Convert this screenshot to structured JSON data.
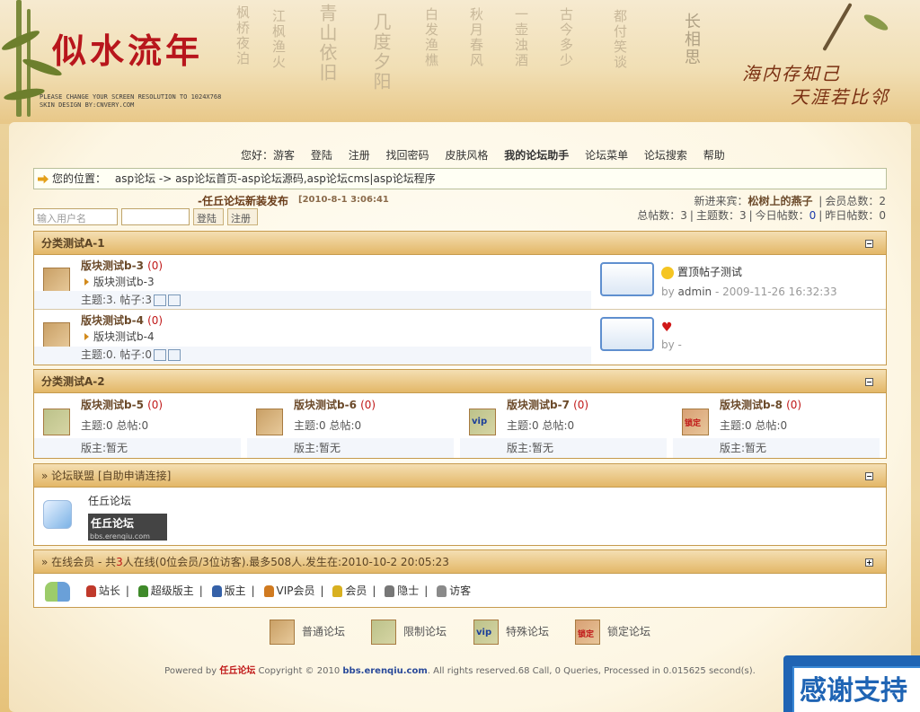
{
  "banner": {
    "title": "似水流年",
    "resolution_note": "PLEASE CHANGE YOUR SCREEN RESOLUTION TO 1024X768",
    "skin_note": "SKIN DESIGN BY:CNVERY.COM",
    "slogan_line1": "海内存知己",
    "slogan_line2": "天涯若比邻"
  },
  "nav": {
    "greeting": "您好：游客",
    "items": [
      "登陆",
      "注册",
      "找回密码",
      "皮肤风格",
      "我的论坛助手",
      "论坛菜单",
      "论坛搜索",
      "帮助"
    ]
  },
  "location": {
    "label": "您的位置：",
    "path": "asp论坛 -> asp论坛首页-asp论坛源码,asp论坛cms|asp论坛程序"
  },
  "login": {
    "username_placeholder": "输入用户名",
    "login_button": "登陆",
    "register_button": "注册"
  },
  "news": {
    "title": "-任丘论坛新装发布",
    "date": "[2010-8-1 3:06:41"
  },
  "stats": {
    "newest_label": "新进来宾：",
    "newest_member": "松树上的燕子",
    "member_total_label": "会员总数：",
    "member_total": "2",
    "posts_label": "总帖数：",
    "posts": "3",
    "topics_label": "主题数：",
    "topics": "3",
    "today_label": "今日帖数：",
    "today": "0",
    "yesterday_label": "昨日帖数：",
    "yesterday": "0"
  },
  "categoryA1": {
    "title": "分类测试A-1",
    "boards": [
      {
        "name": "版块测试b-3",
        "count": "(0)",
        "sub": "版块测试b-3",
        "meta": "主题:3. 帖子:3",
        "last_title": "置顶帖子测试",
        "last_by": "by",
        "last_user": "admin",
        "last_time": "- 2009-11-26 16:32:33"
      },
      {
        "name": "版块测试b-4",
        "count": "(0)",
        "sub": "版块测试b-4",
        "meta": "主题:0. 帖子:0",
        "last_title": "",
        "last_by": "by -",
        "last_user": "",
        "last_time": ""
      }
    ]
  },
  "categoryA2": {
    "title": "分类测试A-2",
    "boards": [
      {
        "name": "版块测试b-5",
        "count": "(0)",
        "meta": "主题:0 总帖:0",
        "mod": "版主:暂无",
        "icon_label": ""
      },
      {
        "name": "版块测试b-6",
        "count": "(0)",
        "meta": "主题:0 总帖:0",
        "mod": "版主:暂无",
        "icon_label": ""
      },
      {
        "name": "版块测试b-7",
        "count": "(0)",
        "meta": "主题:0 总帖:0",
        "mod": "版主:暂无",
        "icon_label": "vip"
      },
      {
        "name": "版块测试b-8",
        "count": "(0)",
        "meta": "主题:0 总帖:0",
        "mod": "版主:暂无",
        "icon_label": "锁定"
      }
    ]
  },
  "friends": {
    "title": "» 论坛联盟 [自助申请连接]",
    "link_name": "任丘论坛",
    "logo_text": "任丘论坛",
    "logo_url": "bbs.erenqiu.com"
  },
  "online": {
    "title_prefix": "» 在线会员  - 共",
    "count": "3",
    "title_suffix": "人在线(0位会员/3位访客).最多508人.发生在:2010-10-2 20:05:23",
    "roles": [
      "站长",
      "超级版主",
      "版主",
      "VIP会员",
      "会员",
      "隐士",
      "访客"
    ],
    "role_colors": [
      "#c0392b",
      "#3f8a2a",
      "#3561a8",
      "#d07a20",
      "#d8b020",
      "#777777",
      "#8a8a8a"
    ]
  },
  "legend": {
    "items": [
      "普通论坛",
      "限制论坛",
      "特殊论坛",
      "锁定论坛"
    ],
    "vip": "vip",
    "lock": "锁定"
  },
  "footer": {
    "powered": "Powered by",
    "brand": "任丘论坛",
    "copyright": "Copyright © 2010",
    "site": "bbs.erenqiu.com",
    "rest": ". All rights reserved.68 Call, 0 Queries, Processed in 0.015625 second(s)."
  },
  "ad": {
    "text": "感谢支持"
  },
  "colors": {
    "accent_red": "#c01818",
    "header_gold": "#e3b767",
    "link_blue": "#2a4a9a"
  }
}
